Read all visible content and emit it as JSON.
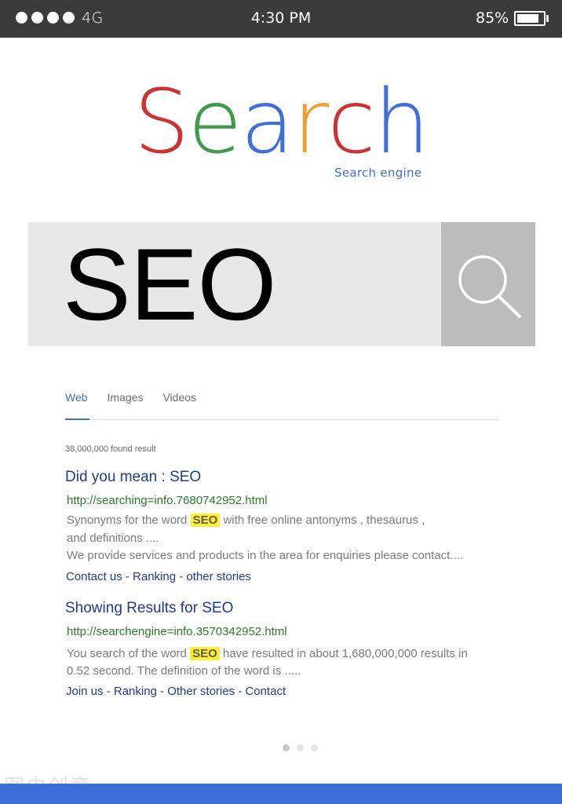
{
  "status_bar": {
    "signal_dot_count": 4,
    "network": "4G",
    "time": "4:30 PM",
    "battery_percent": "85%",
    "battery_level": 0.85
  },
  "logo": {
    "letters": [
      {
        "char": "S",
        "color": "#cf3133"
      },
      {
        "char": "e",
        "color": "#3f9b4b"
      },
      {
        "char": "a",
        "color": "#3f6fd8"
      },
      {
        "char": "r",
        "color": "#e9a131"
      },
      {
        "char": "c",
        "color": "#cf3133"
      },
      {
        "char": "h",
        "color": "#3f6fd8"
      }
    ],
    "subtitle": "Search engine"
  },
  "search": {
    "query": "SEO",
    "button_icon": "magnifier-icon"
  },
  "tabs": [
    {
      "label": "Web",
      "active": true
    },
    {
      "label": "Images",
      "active": false
    },
    {
      "label": "Videos",
      "active": false
    }
  ],
  "result_count": "38,000,000 found result",
  "results": [
    {
      "title": "Did you mean : SEO",
      "url": "http://searching=info.7680742952.html",
      "line1_before": "Synonyms for the word",
      "line1_highlight": "SEO",
      "line1_after": "with free online antonyms , thesaurus ,",
      "line2": "and definitions ....",
      "line3": "We provide services and products in the area for enquiries please contact....",
      "links": "Contact us - Ranking - other stories"
    },
    {
      "title": "Showing Results for SEO",
      "url": "http://searchengine=info.3570342952.html",
      "line1_before": "You search of the word",
      "line1_highlight": "SEO",
      "line1_after": "have resulted in about 1,680,000,000 results in",
      "line2": "0.52 second. The definition of the word is .....",
      "links": "Join us - Ranking - Other stories - Contact"
    }
  ],
  "pager": {
    "pages": 3,
    "current": 1
  },
  "watermark": "图虫创意",
  "colors": {
    "status_bar": "#3b3b3c",
    "accent": "#3f6fd8",
    "link": "#1f3a93",
    "url": "#2c7a2c",
    "highlight": "#ffee32"
  }
}
